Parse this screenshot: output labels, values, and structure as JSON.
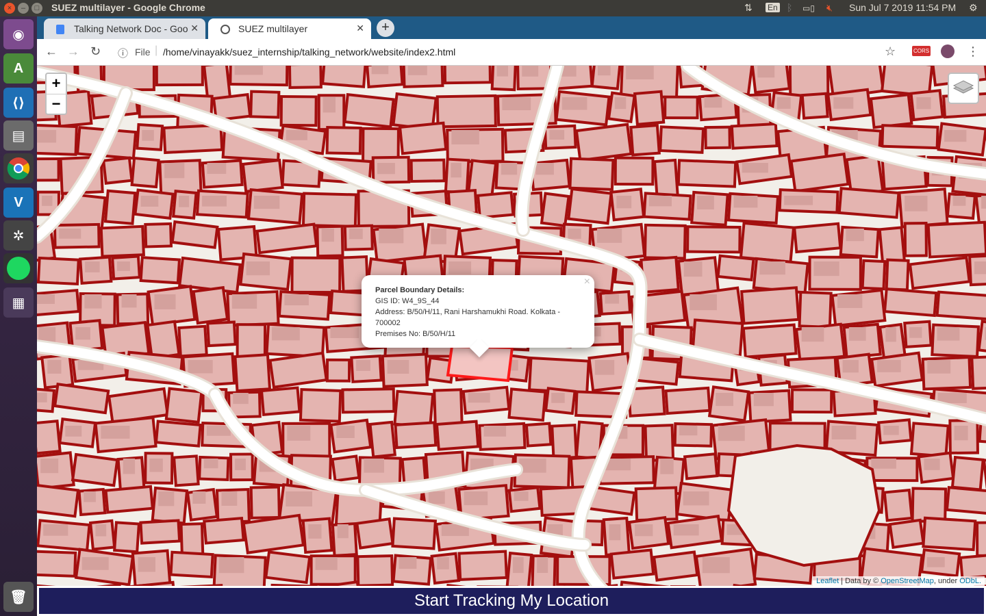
{
  "topbar": {
    "window_title": "SUEZ multilayer - Google Chrome",
    "lang": "En",
    "clock": "Sun Jul  7 2019 11:54 PM"
  },
  "launcher": {
    "items": [
      "ubuntu-dash",
      "android-studio",
      "vscode",
      "files",
      "chrome",
      "vnc",
      "network-tool",
      "spotify",
      "workspaces",
      "trash"
    ]
  },
  "tabs": [
    {
      "label": "Talking Network Doc - Goo",
      "icon": "docs-icon",
      "active": false
    },
    {
      "label": "SUEZ multilayer",
      "icon": "globe-icon",
      "active": true
    }
  ],
  "toolbar": {
    "scheme_label": "File",
    "url": "/home/vinayakk/suez_internship/talking_network/website/index2.html"
  },
  "map": {
    "zoom_in": "+",
    "zoom_out": "−",
    "popup": {
      "heading": "Parcel Boundary Details:",
      "gis_id": "GIS ID: W4_9S_44",
      "address": "Address: B/50/H/11, Rani Harshamukhi Road. Kolkata - 700002",
      "premises": "Premises No: B/50/H/11",
      "close": "×"
    },
    "attribution": {
      "leaflet": "Leaflet",
      "data_by": " | Data by © ",
      "osm": "OpenStreetMap",
      "under": ", under ",
      "odbl": "ODbL."
    },
    "parcel_fill": "#e4b4b0",
    "parcel_stroke": "#a30f0f",
    "road_color": "#ffffff"
  },
  "footer": {
    "track_button": "Start Tracking My Location",
    "button_color": "#1e1e5c"
  }
}
